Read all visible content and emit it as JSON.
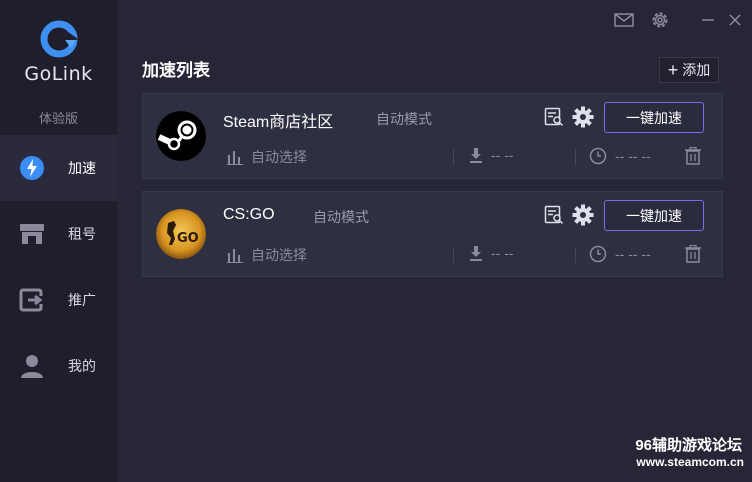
{
  "app": {
    "name": "GoLink",
    "edition": "体验版"
  },
  "nav": {
    "items": [
      {
        "label": "加速",
        "icon": "lightning-icon",
        "active": true
      },
      {
        "label": "租号",
        "icon": "store-icon",
        "active": false
      },
      {
        "label": "推广",
        "icon": "share-icon",
        "active": false
      },
      {
        "label": "我的",
        "icon": "user-icon",
        "active": false
      }
    ]
  },
  "titlebar": {
    "icons": [
      "mail-icon",
      "settings-icon",
      "minimize-icon",
      "close-icon"
    ]
  },
  "main": {
    "title": "加速列表",
    "add_label": "添加"
  },
  "games": [
    {
      "name": "Steam商店社区",
      "mode": "自动模式",
      "button_label": "一键加速",
      "node_label": "自动选择",
      "download": "-- --",
      "time": "-- -- --",
      "icon": "steam-logo"
    },
    {
      "name": "CS:GO",
      "mode": "自动模式",
      "button_label": "一键加速",
      "node_label": "自动选择",
      "download": "-- --",
      "time": "-- -- --",
      "icon": "csgo-logo"
    }
  ],
  "watermark": {
    "title": "96辅助游戏论坛",
    "url": "www.steamcom.cn"
  },
  "colors": {
    "accent_purple": "#7a6ee8",
    "logo_blue": "#3f8ff0",
    "bolt_blue": "#3a8ef6"
  }
}
